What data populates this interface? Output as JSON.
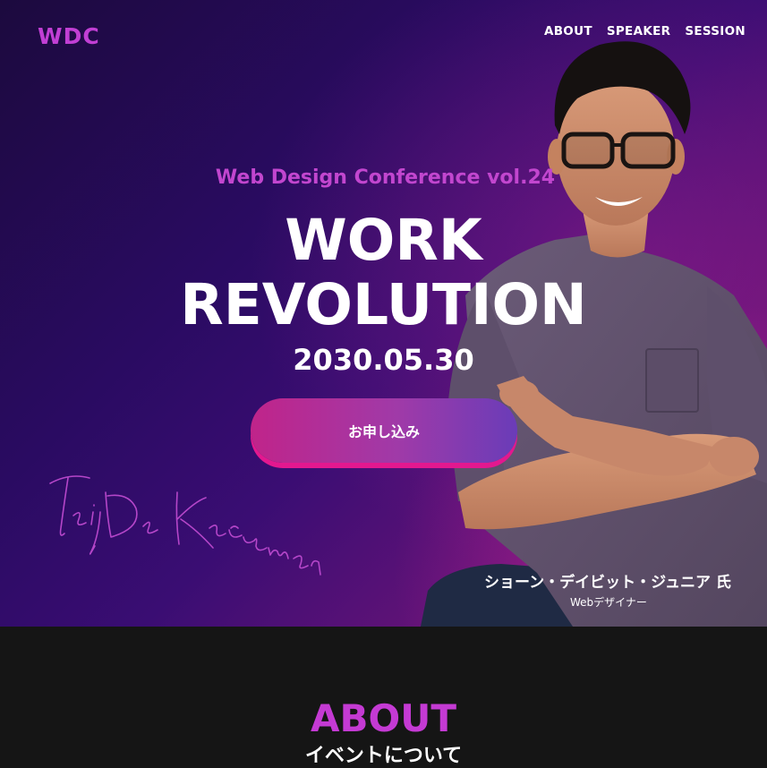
{
  "header": {
    "logo": "WDC",
    "nav": [
      "ABOUT",
      "SPEAKER",
      "SESSION"
    ]
  },
  "hero": {
    "subtitle": "Web Design Conference vol.24",
    "title_line1": "WORK",
    "title_line2": "REVOLUTION",
    "date": "2030.05.30",
    "cta_label": "お申し込み",
    "signature": "Teiji De Kaerumon",
    "speaker_name": "ショーン・デイビット・ジュニア 氏",
    "speaker_role": "Webデザイナー"
  },
  "about": {
    "title": "ABOUT",
    "subtitle": "イベントについて"
  },
  "colors": {
    "accent": "#c13fd4",
    "cta_pink": "#e3188f",
    "bg_dark": "#151515"
  }
}
